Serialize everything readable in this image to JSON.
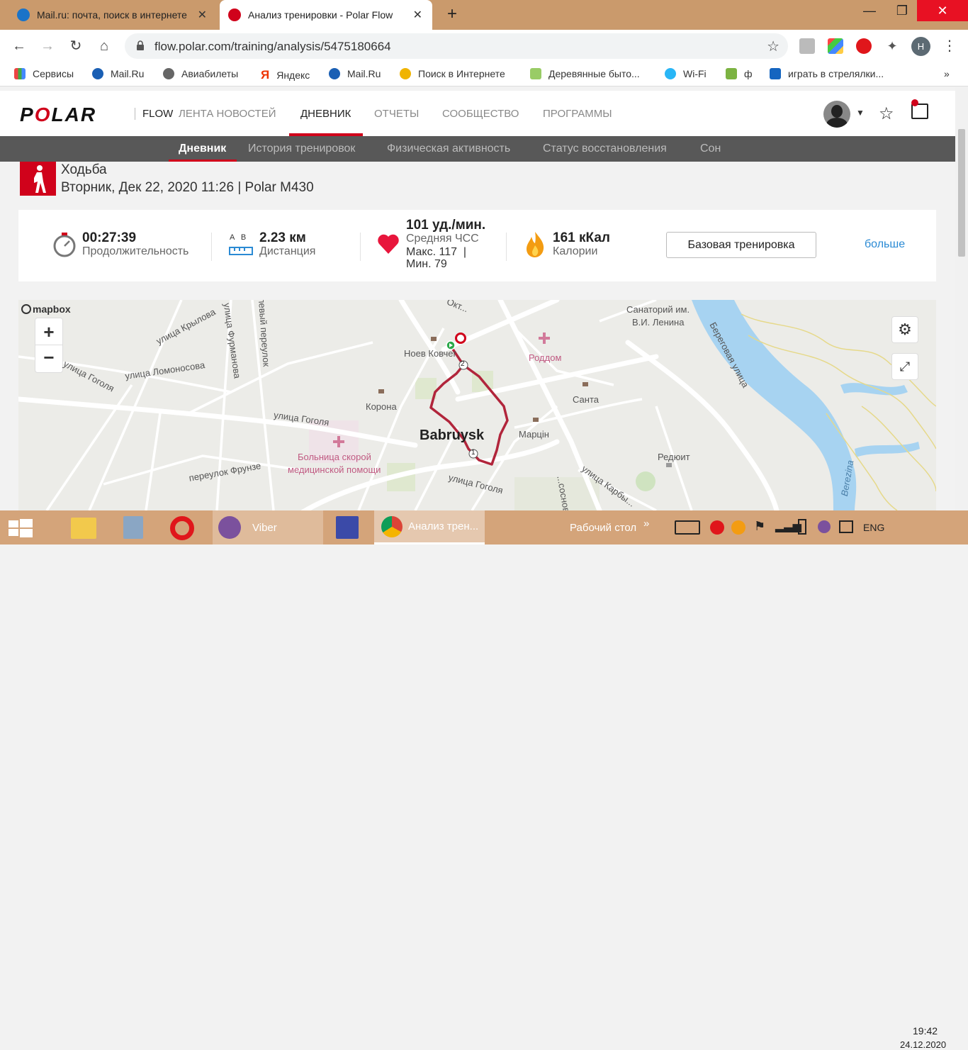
{
  "browser": {
    "tabs": [
      {
        "title": "Mail.ru: почта, поиск в интернете"
      },
      {
        "title": "Анализ тренировки - Polar Flow"
      }
    ],
    "url": "flow.polar.com/training/analysis/5475180664",
    "profile_initial": "H",
    "bookmarks": [
      {
        "label": "Сервисы"
      },
      {
        "label": "Mail.Ru"
      },
      {
        "label": "Авиабилеты"
      },
      {
        "label": "Яндекс"
      },
      {
        "label": "Mail.Ru"
      },
      {
        "label": "Поиск в Интернете"
      },
      {
        "label": "Деревянные быто..."
      },
      {
        "label": "Wi-Fi"
      },
      {
        "label": "ф"
      },
      {
        "label": "играть в стрелялки..."
      }
    ],
    "bookmarks_more": "»"
  },
  "polar": {
    "logo": "POLAR",
    "flow_label": "FLOW",
    "main_nav": [
      "ЛЕНТА НОВОСТЕЙ",
      "ДНЕВНИК",
      "ОТЧЕТЫ",
      "СООБЩЕСТВО",
      "ПРОГРАММЫ"
    ],
    "sub_nav": [
      "Дневник",
      "История тренировок",
      "Физическая активность",
      "Статус восстановления",
      "Сон"
    ]
  },
  "activity": {
    "title": "Ходьба",
    "subtitle": "Вторник, Дек 22, 2020 11:26 | Polar M430",
    "duration_value": "00:27:39",
    "duration_label": "Продолжительность",
    "distance_ab": "A   B",
    "distance_value": "2.23 км",
    "distance_label": "Дистанция",
    "hr_value": "101 уд./мин.",
    "hr_label": "Средняя ЧСС",
    "hr_max": "Макс. 117  |",
    "hr_min": "Мин. 79",
    "calories_value": "161 кКал",
    "calories_label": "Калории",
    "training_button": "Базовая тренировка",
    "more_link": "больше"
  },
  "map": {
    "attribution": "mapbox",
    "zoom_in": "+",
    "zoom_out": "−",
    "labels": {
      "city": "Babruysk",
      "sanatorium": "Санаторий им.",
      "sanatorium2": "В.И. Ленина",
      "roddom": "Роддом",
      "novy_kovcheg": "Ноев Ковчег",
      "korona": "Корона",
      "santa": "Санта",
      "martsin": "Марцін",
      "reduit": "Редюит",
      "hospital1": "Больница скорой",
      "hospital2": "медицинской помощи",
      "st_krylova": "улица Крылова",
      "st_furmanova": "улица Фурманова",
      "st_lomonosova": "улица Ломоносова",
      "st_gogolya": "улица Гоголя",
      "st_gogolya2": "улица Гоголя",
      "st_gogolya3": "улица Гоголя",
      "per_frunze": "переулок Фрунзе",
      "per_levy": "левый переулок",
      "st_beregovaya": "Береговая улица",
      "st_karbysheva": "улица Карбы...",
      "st_oktyabr": "Окт...",
      "st_sosnova": "...сосновa",
      "river": "Berezina",
      "marker1": "1",
      "marker2": "2"
    }
  },
  "taskbar": {
    "viber": "Viber",
    "chrome": "Анализ трен...",
    "desktop": "Рабочий стол",
    "chevron": "»",
    "lang": "ENG",
    "time": "19:42",
    "date": "24.12.2020"
  }
}
